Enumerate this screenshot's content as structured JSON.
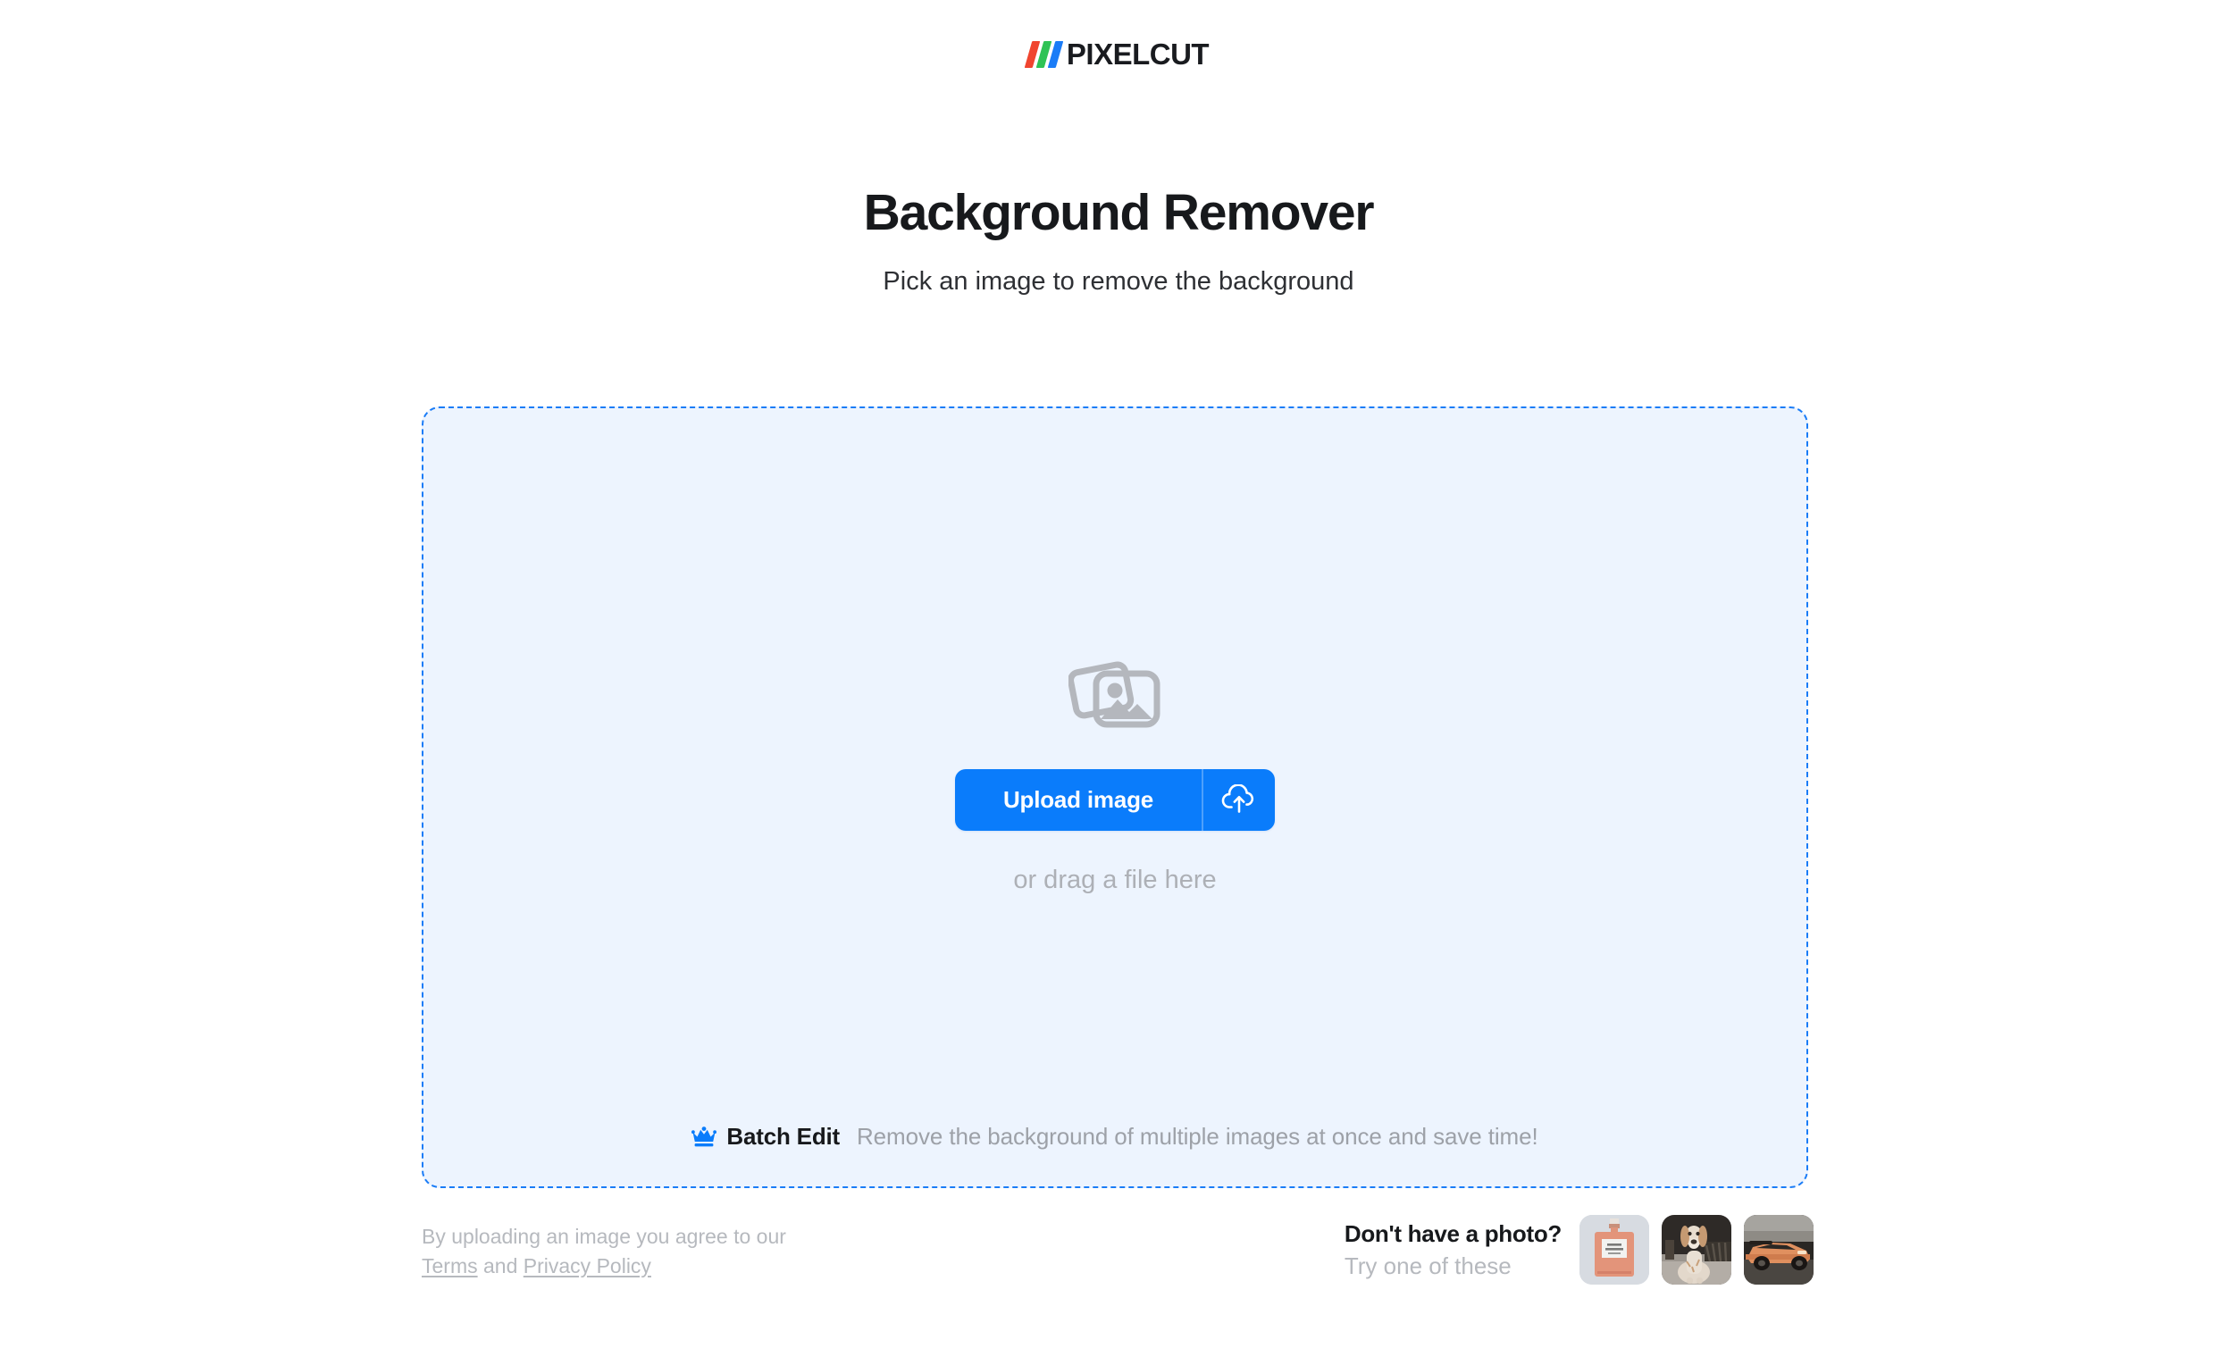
{
  "brand": {
    "name": "PIXELCUT",
    "logo_icon": "three-slash-bars-icon",
    "bar_colors": [
      "#f0452f",
      "#2fc355",
      "#1a7cf7"
    ]
  },
  "header": {
    "title": "Background Remover",
    "subtitle": "Pick an image to remove the background"
  },
  "dropzone": {
    "placeholder_icon": "images-stack-icon",
    "upload_button_label": "Upload image",
    "upload_icon": "cloud-upload-icon",
    "drag_hint": "or drag a file here",
    "background_color": "#edf4fe",
    "border_color": "#1a7cf7",
    "button_color": "#0a7cfb"
  },
  "batch_edit": {
    "icon": "crown-icon",
    "label": "Batch Edit",
    "description": "Remove the background of multiple images at once and save time!",
    "crown_color": "#0a7cfb"
  },
  "legal": {
    "prefix": "By uploading an image you agree to our",
    "terms_label": "Terms",
    "conjunction": "and",
    "privacy_label": "Privacy Policy"
  },
  "samples": {
    "title": "Don't have a photo?",
    "subtitle": "Try one of these",
    "thumbnails": [
      {
        "name": "perfume-bottle-thumbnail",
        "alt": "Perfume bottle on light gray background"
      },
      {
        "name": "dog-thumbnail",
        "alt": "Tan and white dog sitting outdoors"
      },
      {
        "name": "sports-car-thumbnail",
        "alt": "Orange sports car on a road"
      }
    ]
  }
}
